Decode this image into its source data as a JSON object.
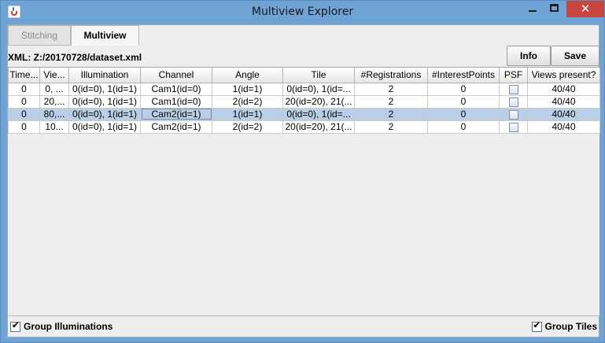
{
  "window": {
    "title": "Multiview Explorer",
    "close_glyph": "✕"
  },
  "tabs": [
    {
      "label": "Stitching",
      "active": false
    },
    {
      "label": "Multiview",
      "active": true
    }
  ],
  "xml_label": "XML: Z:/20170728/dataset.xml",
  "buttons": {
    "info": "Info",
    "save": "Save"
  },
  "table": {
    "columns": [
      "Time...",
      "Vie...",
      "Illumination",
      "Channel",
      "Angle",
      "Tile",
      "#Registrations",
      "#InterestPoints",
      "PSF",
      "Views present?"
    ],
    "rows": [
      {
        "cells": [
          "0",
          "0, ...",
          "0(id=0), 1(id=1)",
          "Cam1(id=0)",
          "1(id=1)",
          "0(id=0), 1(id=...",
          "2",
          "0",
          "",
          "40/40"
        ],
        "psf_checked": false,
        "selected": false
      },
      {
        "cells": [
          "0",
          "20,...",
          "0(id=0), 1(id=1)",
          "Cam1(id=0)",
          "2(id=2)",
          "20(id=20), 21(...",
          "2",
          "0",
          "",
          "40/40"
        ],
        "psf_checked": false,
        "selected": false
      },
      {
        "cells": [
          "0",
          "80,...",
          "0(id=0), 1(id=1)",
          "Cam2(id=1)",
          "1(id=1)",
          "0(id=0), 1(id=...",
          "2",
          "0",
          "",
          "40/40"
        ],
        "psf_checked": false,
        "selected": true
      },
      {
        "cells": [
          "0",
          "10...",
          "0(id=0), 1(id=1)",
          "Cam2(id=1)",
          "2(id=2)",
          "20(id=20), 21(...",
          "2",
          "0",
          "",
          "40/40"
        ],
        "psf_checked": false,
        "selected": false
      }
    ]
  },
  "checkboxes": {
    "group_illuminations": {
      "label": "Group Illuminations",
      "checked": true
    },
    "group_tiles": {
      "label": "Group Tiles",
      "checked": true
    }
  },
  "colors": {
    "titlebar": "#6fa3d6",
    "close": "#c7463d",
    "selection": "#b8cfe5"
  },
  "icons": {
    "app": "java-icon",
    "minimize": "minimize-icon",
    "maximize": "maximize-icon",
    "close": "close-icon"
  }
}
